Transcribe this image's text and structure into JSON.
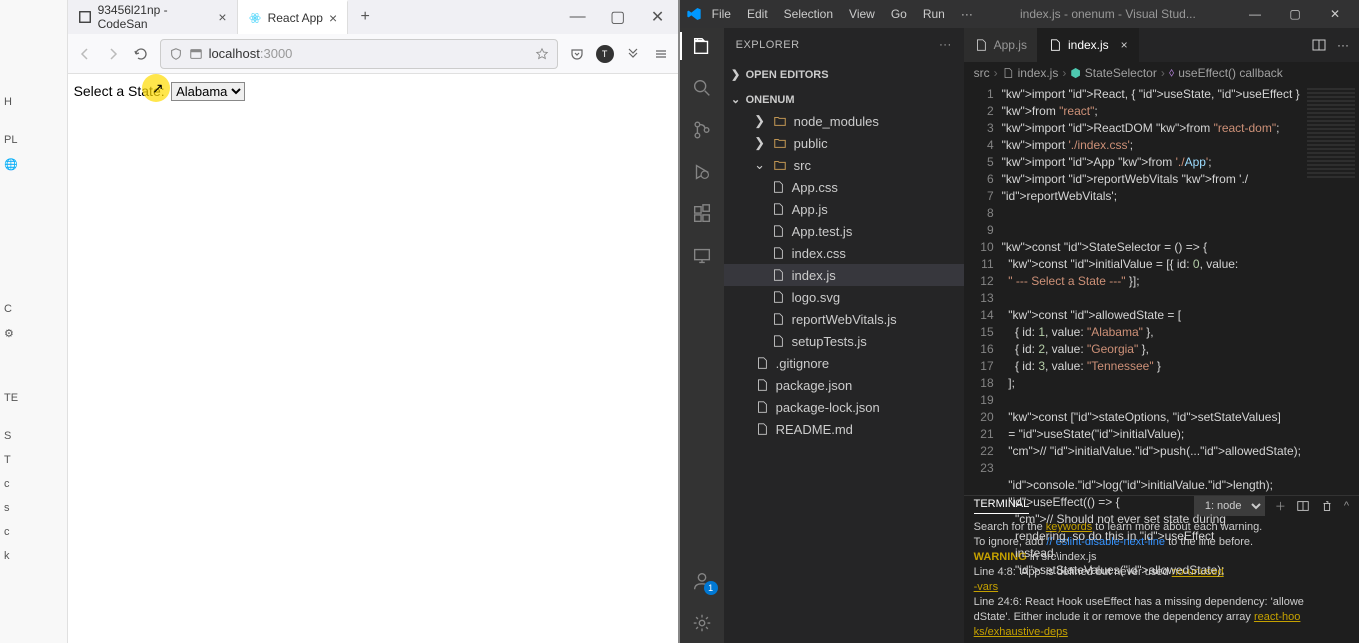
{
  "bg": {
    "items": [
      "",
      "",
      "H",
      "PL",
      "🌐",
      "C",
      "⚙",
      "TE",
      "S",
      "T",
      "c",
      "s",
      "c",
      "k"
    ]
  },
  "browser": {
    "tabs": [
      {
        "title": "93456l21np - CodeSan"
      },
      {
        "title": "React App"
      }
    ],
    "url_prefix": "localhost",
    "url_suffix": ":3000",
    "page_label": "Select a State:",
    "select_value": "Alabama"
  },
  "vscode": {
    "menu": [
      "File",
      "Edit",
      "Selection",
      "View",
      "Go",
      "Run"
    ],
    "title": "index.js - onenum - Visual Stud...",
    "explorer": {
      "header": "EXPLORER",
      "open_editors": "OPEN EDITORS",
      "project": "ONENUM",
      "tree": [
        {
          "name": "node_modules",
          "folder": true,
          "open": false,
          "ind": 1
        },
        {
          "name": "public",
          "folder": true,
          "open": false,
          "ind": 1
        },
        {
          "name": "src",
          "folder": true,
          "open": true,
          "ind": 1
        },
        {
          "name": "App.css",
          "ind": 2
        },
        {
          "name": "App.js",
          "ind": 2
        },
        {
          "name": "App.test.js",
          "ind": 2
        },
        {
          "name": "index.css",
          "ind": 2
        },
        {
          "name": "index.js",
          "ind": 2,
          "sel": true
        },
        {
          "name": "logo.svg",
          "ind": 2
        },
        {
          "name": "reportWebVitals.js",
          "ind": 2
        },
        {
          "name": "setupTests.js",
          "ind": 2
        },
        {
          "name": ".gitignore",
          "ind": 1
        },
        {
          "name": "package.json",
          "ind": 1
        },
        {
          "name": "package-lock.json",
          "ind": 1
        },
        {
          "name": "README.md",
          "ind": 1
        }
      ]
    },
    "tabs": [
      {
        "name": "App.js"
      },
      {
        "name": "index.js",
        "active": true
      }
    ],
    "breadcrumb": [
      "src",
      "index.js",
      "StateSelector",
      "useEffect() callback"
    ],
    "code_lines": [
      "import React, { useState, useEffect } ",
      "from \"react\";",
      "import ReactDOM from \"react-dom\";",
      "import './index.css';",
      "import App from './App';",
      "import reportWebVitals from './",
      "reportWebVitals';",
      "",
      "",
      "const StateSelector = () => {",
      "  const initialValue = [{ id: 0, value:",
      "  \" --- Select a State ---\" }];",
      "",
      "  const allowedState = [",
      "    { id: 1, value: \"Alabama\" },",
      "    { id: 2, value: \"Georgia\" },",
      "    { id: 3, value: \"Tennessee\" }",
      "  ];",
      "",
      "  const [stateOptions, setStateValues]",
      "  = useState(initialValue);",
      "  // initialValue.push(...allowedState);",
      "",
      "  console.log(initialValue.length);",
      "  useEffect(() => {",
      "    // Should not ever set state during ",
      "    rendering, so do this in useEffect ",
      "    instead.",
      "    setStateValues(allowedState);"
    ],
    "line_numbers": [
      1,
      1,
      2,
      3,
      4,
      5,
      5,
      6,
      7,
      8,
      9,
      9,
      10,
      11,
      12,
      13,
      14,
      15,
      16,
      17,
      17,
      18,
      19,
      20,
      21,
      22,
      22,
      22,
      23
    ],
    "line_number_display": [
      "1",
      "",
      "2",
      "3",
      "4",
      "5",
      "",
      "6",
      "7",
      "8",
      "9",
      "",
      "10",
      "11",
      "12",
      "13",
      "14",
      "15",
      "16",
      "17",
      "",
      "18",
      "19",
      "20",
      "21",
      "22",
      "",
      "",
      "23"
    ],
    "terminal": {
      "tab_label": "TERMINAL",
      "select": "1: node",
      "lines": [
        {
          "text": "Search for the ",
          "parts": [
            {
              "t": "Search for the "
            },
            {
              "t": "keywords",
              "cls": "y"
            },
            {
              "t": " to learn more about each warning."
            }
          ]
        },
        {
          "parts": [
            {
              "t": "To ignore, add "
            },
            {
              "t": "// eslint-disable-next-line",
              "cls": "cy"
            },
            {
              "t": " to the line before."
            }
          ]
        },
        {
          "parts": [
            {
              "t": ""
            }
          ]
        },
        {
          "parts": [
            {
              "t": "WARNING",
              "cls": "warn"
            },
            {
              "t": " in src\\index.js"
            }
          ]
        },
        {
          "parts": [
            {
              "t": "  Line 4:8:   'App' is defined but never used                                             "
            },
            {
              "t": "no-unused",
              "cls": "y"
            }
          ]
        },
        {
          "parts": [
            {
              "t": "-vars",
              "cls": "y"
            }
          ]
        },
        {
          "parts": [
            {
              "t": "  Line 24:6:  React Hook useEffect has a missing dependency: 'allowe"
            }
          ]
        },
        {
          "parts": [
            {
              "t": "dState'. Either include it or remove the dependency array  "
            },
            {
              "t": "react-hoo",
              "cls": "y"
            }
          ]
        },
        {
          "parts": [
            {
              "t": "ks/exhaustive-deps",
              "cls": "y"
            }
          ]
        }
      ]
    },
    "source_control_badge": "1"
  }
}
